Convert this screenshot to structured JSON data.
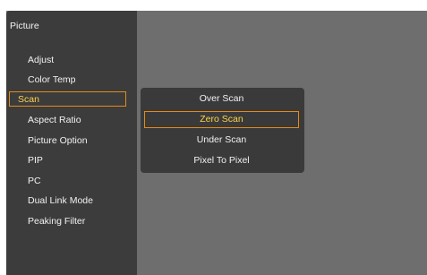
{
  "menu": {
    "title": "Picture",
    "items": [
      {
        "label": "Adjust"
      },
      {
        "label": "Color Temp"
      },
      {
        "label": "Scan"
      },
      {
        "label": "Aspect Ratio"
      },
      {
        "label": "Picture Option"
      },
      {
        "label": "PIP"
      },
      {
        "label": "PC"
      },
      {
        "label": "Dual Link Mode"
      },
      {
        "label": "Peaking Filter"
      }
    ],
    "selected_index": 2
  },
  "submenu": {
    "items": [
      {
        "label": "Over Scan"
      },
      {
        "label": "Zero Scan"
      },
      {
        "label": "Under Scan"
      },
      {
        "label": "Pixel To Pixel"
      }
    ],
    "selected_index": 1
  },
  "colors": {
    "highlight_border": "#e38a1a",
    "highlight_text": "#ffd24a",
    "panel_bg": "#3c3c3c",
    "screen_bg": "#6e6e6e",
    "text": "#f2f2f2"
  }
}
